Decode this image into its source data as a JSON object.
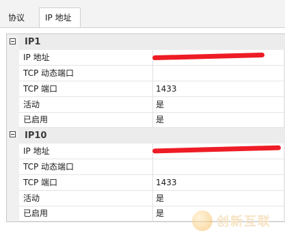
{
  "tabs": [
    {
      "label": "协议",
      "active": false
    },
    {
      "label": "IP 地址",
      "active": true
    }
  ],
  "groups": [
    {
      "name": "IP1",
      "properties": [
        {
          "key": "IP 地址",
          "value": ""
        },
        {
          "key": "TCP 动态端口",
          "value": ""
        },
        {
          "key": "TCP 端口",
          "value": "1433"
        },
        {
          "key": "活动",
          "value": "是"
        },
        {
          "key": "已启用",
          "value": "是"
        }
      ]
    },
    {
      "name": "IP10",
      "properties": [
        {
          "key": "IP 地址",
          "value": ""
        },
        {
          "key": "TCP 动态端口",
          "value": ""
        },
        {
          "key": "TCP 端口",
          "value": "1433"
        },
        {
          "key": "活动",
          "value": "是"
        },
        {
          "key": "已启用",
          "value": "是"
        }
      ]
    }
  ],
  "watermark": {
    "text": "创新互联"
  },
  "colors": {
    "redaction": "#ee1c25",
    "group_header": "#ececec"
  }
}
